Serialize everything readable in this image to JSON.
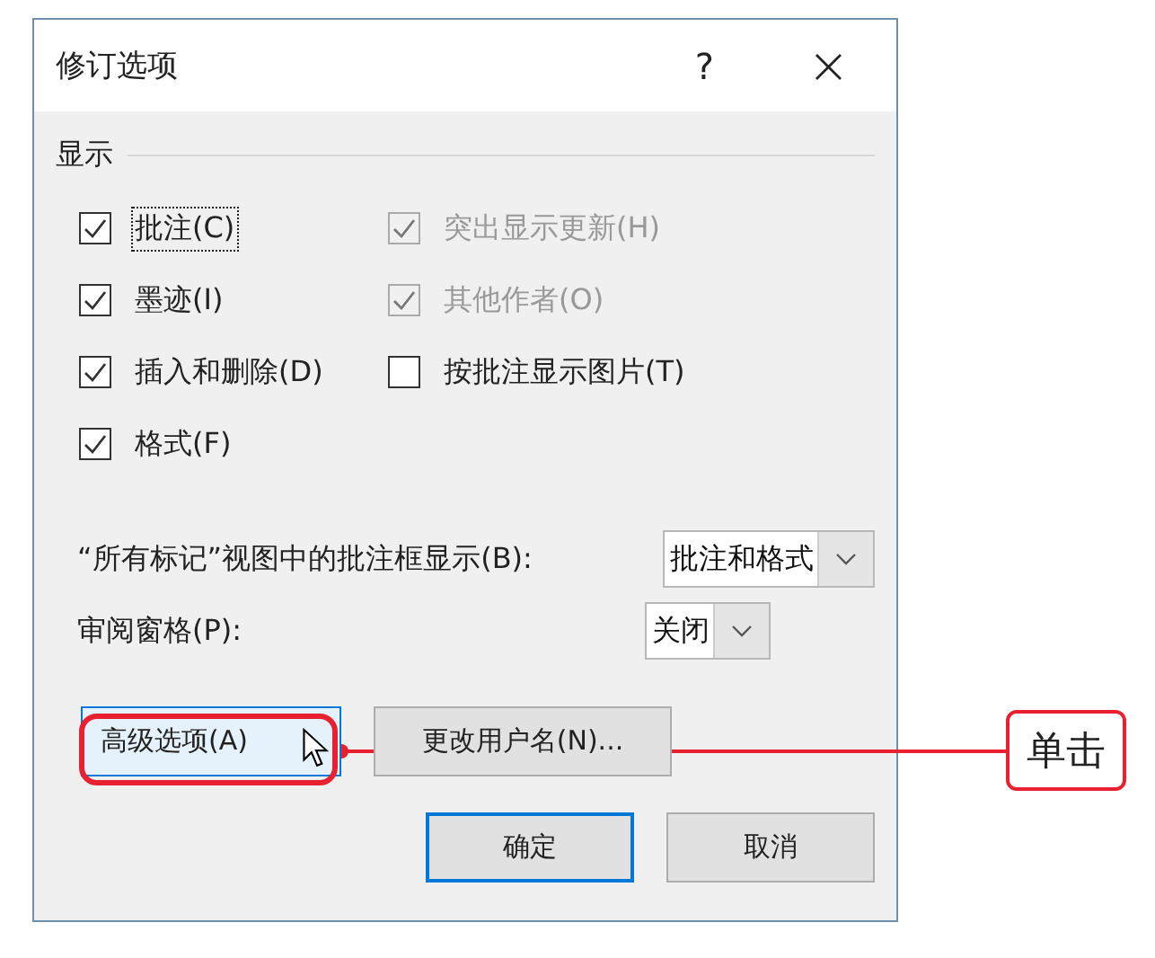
{
  "window": {
    "title": "修订选项",
    "help": "?",
    "close": "×"
  },
  "section": {
    "title": "显示"
  },
  "options": [
    {
      "label": "批注(C)",
      "checked": true,
      "disabled": false,
      "focused": true
    },
    {
      "label": "突出显示更新(H)",
      "checked": true,
      "disabled": true,
      "focused": false
    },
    {
      "label": "墨迹(I)",
      "checked": true,
      "disabled": false,
      "focused": false
    },
    {
      "label": "其他作者(O)",
      "checked": true,
      "disabled": true,
      "focused": false
    },
    {
      "label": "插入和删除(D)",
      "checked": true,
      "disabled": false,
      "focused": false
    },
    {
      "label": "按批注显示图片(T)",
      "checked": false,
      "disabled": false,
      "focused": false
    },
    {
      "label": "格式(F)",
      "checked": true,
      "disabled": false,
      "focused": false
    }
  ],
  "dropdowns": [
    {
      "label": "“所有标记”视图中的批注框显示(B):",
      "value": "批注和格式"
    },
    {
      "label": "审阅窗格(P):",
      "value": "关闭"
    }
  ],
  "buttons": [
    {
      "label": "高级选项(A)",
      "highlighted": true,
      "default": false
    },
    {
      "label": "更改用户名(N)...",
      "highlighted": false,
      "default": false
    }
  ],
  "footer_buttons": [
    {
      "label": "确定",
      "highlighted": false,
      "default": true
    },
    {
      "label": "取消",
      "highlighted": false,
      "default": false
    }
  ],
  "callout": {
    "text": "单击"
  }
}
